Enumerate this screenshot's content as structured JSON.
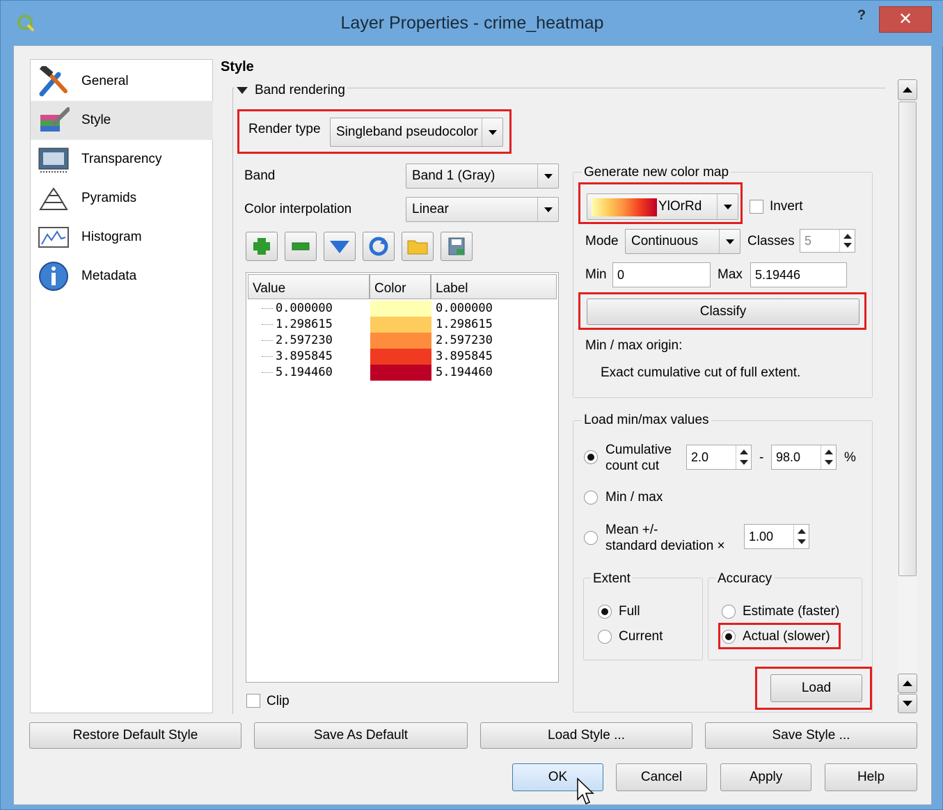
{
  "window": {
    "title": "Layer Properties - crime_heatmap",
    "help": "?",
    "close": "✕"
  },
  "nav": {
    "items": [
      {
        "label": "General",
        "icon": "tools-icon"
      },
      {
        "label": "Style",
        "icon": "paintbrush-icon"
      },
      {
        "label": "Transparency",
        "icon": "transparency-icon"
      },
      {
        "label": "Pyramids",
        "icon": "pyramids-icon"
      },
      {
        "label": "Histogram",
        "icon": "histogram-icon"
      },
      {
        "label": "Metadata",
        "icon": "info-icon"
      }
    ],
    "selected": "Style"
  },
  "style": {
    "heading": "Style",
    "band_rendering": "Band rendering",
    "render_type_label": "Render type",
    "render_type_value": "Singleband pseudocolor",
    "band_label": "Band",
    "band_value": "Band 1 (Gray)",
    "interp_label": "Color interpolation",
    "interp_value": "Linear",
    "table": {
      "headers": [
        "Value",
        "Color",
        "Label"
      ],
      "rows": [
        {
          "value": "0.000000",
          "color": "#ffffb2",
          "label": "0.000000"
        },
        {
          "value": "1.298615",
          "color": "#fecc5c",
          "label": "1.298615"
        },
        {
          "value": "2.597230",
          "color": "#fd8d3c",
          "label": "2.597230"
        },
        {
          "value": "3.895845",
          "color": "#f03b20",
          "label": "3.895845"
        },
        {
          "value": "5.194460",
          "color": "#bd0026",
          "label": "5.194460"
        }
      ]
    },
    "clip_label": "Clip",
    "gen": {
      "title": "Generate new color map",
      "ramp": "YlOrRd",
      "invert": "Invert",
      "mode_label": "Mode",
      "mode_value": "Continuous",
      "classes_label": "Classes",
      "classes_value": "5",
      "min_label": "Min",
      "min_value": "0",
      "max_label": "Max",
      "max_value": "5.19446",
      "classify": "Classify",
      "origin_label": "Min / max origin:",
      "origin_text": "Exact cumulative cut of full extent."
    },
    "load": {
      "title": "Load min/max values",
      "cumulative_line1": "Cumulative",
      "cumulative_line2": "count cut",
      "cum_low": "2.0",
      "dash": "-",
      "cum_high": "98.0",
      "pct": "%",
      "minmax": "Min / max",
      "mean_line1": "Mean +/-",
      "mean_line2": "standard deviation ×",
      "stddev": "1.00",
      "extent_title": "Extent",
      "full": "Full",
      "current": "Current",
      "accuracy_title": "Accuracy",
      "estimate": "Estimate (faster)",
      "actual": "Actual (slower)",
      "load_btn": "Load"
    }
  },
  "bottom": {
    "restore": "Restore Default Style",
    "save_default": "Save As Default",
    "load_style": "Load Style ...",
    "save_style": "Save Style ...",
    "ok": "OK",
    "cancel": "Cancel",
    "apply": "Apply",
    "help": "Help"
  }
}
